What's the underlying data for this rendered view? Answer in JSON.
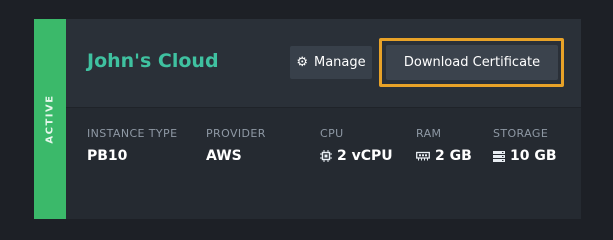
{
  "instance": {
    "status": "ACTIVE",
    "name": "John's Cloud",
    "buttons": {
      "manage": "Manage",
      "download_certificate": "Download Certificate"
    },
    "specs": [
      {
        "label": "INSTANCE TYPE",
        "value": "PB10",
        "icon": ""
      },
      {
        "label": "PROVIDER",
        "value": "AWS",
        "icon": ""
      },
      {
        "label": "CPU",
        "value": "2 vCPU",
        "icon": "cpu-icon"
      },
      {
        "label": "RAM",
        "value": "2 GB",
        "icon": "memory-icon"
      },
      {
        "label": "STORAGE",
        "value": "10 GB",
        "icon": "storage-icon"
      }
    ]
  },
  "colors": {
    "status_active": "#3bb96a",
    "title": "#3fc1a0",
    "highlight": "#e8a228"
  }
}
